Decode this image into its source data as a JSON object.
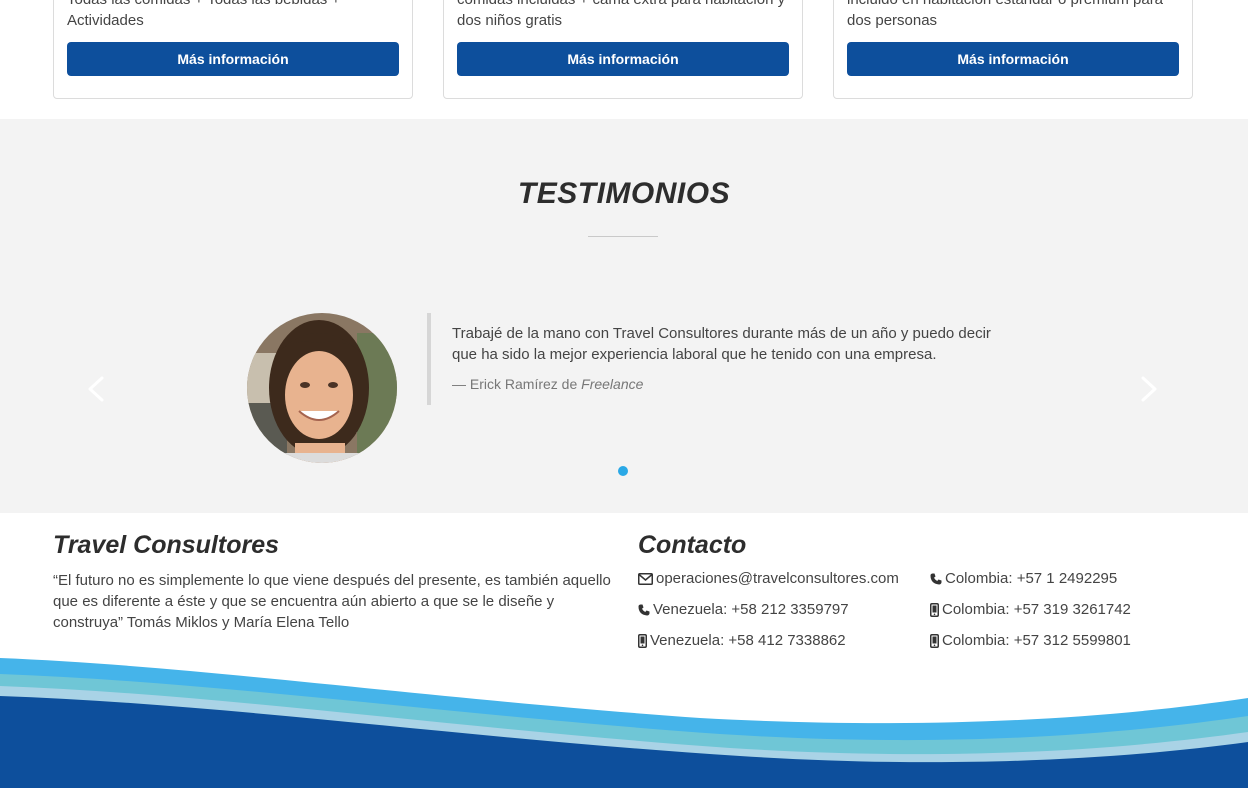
{
  "cards": [
    {
      "desc": "Todas las comidas + Todas las bebidas + Actividades",
      "button": "Más información"
    },
    {
      "desc": "comidas incluidas + cama extra para habitación y dos niños gratis",
      "button": "Más información"
    },
    {
      "desc": "incluido en habitación estándar o premium para dos personas",
      "button": "Más información"
    }
  ],
  "testimonials": {
    "title": "TESTIMONIOS",
    "quote": "Trabajé de la mano con Travel Consultores durante más de un año y puedo decir que ha sido la mejor experiencia laboral que he tenido con una empresa.",
    "author_prefix": "— ",
    "author_name": "Erick Ramírez de ",
    "author_company": "Freelance"
  },
  "footer": {
    "brand_title": "Travel Consultores",
    "brand_quote": "“El futuro no es simplemente lo que viene después del presente, es también aquello que es diferente a éste y que se encuentra aún abierto a que se le diseñe y construya” Tomás Miklos y María Elena Tello",
    "contact_title": "Contacto",
    "contacts": [
      {
        "icon": "envelope-icon",
        "text": "operaciones@travelconsultores.com"
      },
      {
        "icon": "phone-icon",
        "text": "Venezuela: +58 212 3359797"
      },
      {
        "icon": "mobile-icon",
        "text": "Venezuela: +58 412 7338862"
      },
      {
        "icon": "phone-icon",
        "text": "Colombia: +57 1 2492295"
      },
      {
        "icon": "mobile-icon",
        "text": "Colombia: +57 319 3261742"
      },
      {
        "icon": "mobile-icon",
        "text": "Colombia: +57 312 5599801"
      }
    ]
  },
  "colors": {
    "button": "#0d4f9c",
    "wave_dark": "#0d4f9c",
    "wave_light": "#45b4ea",
    "wave_teal": "#6fc6d6",
    "dot_active": "#2aa8e6"
  }
}
